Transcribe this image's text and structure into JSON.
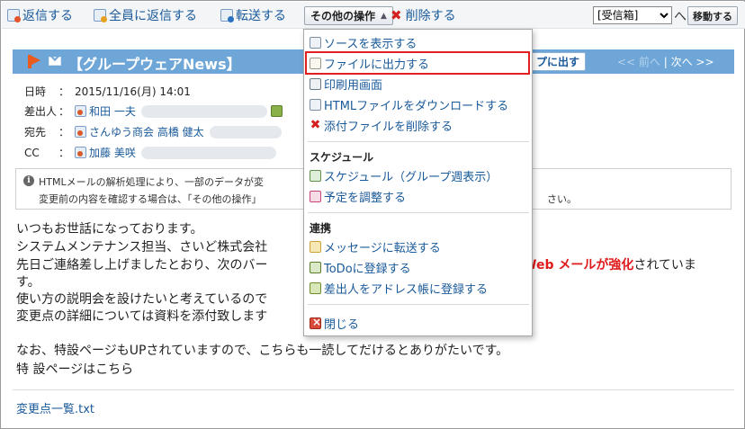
{
  "toolbar": {
    "reply": "返信する",
    "reply_all": "全員に返信する",
    "forward": "転送する",
    "other_actions": "その他の操作",
    "delete": "削除する",
    "folder_selected": "[受信箱]",
    "folder_suffix": "へ",
    "move": "移動する"
  },
  "message": {
    "subject": "【グループウェアNews】",
    "popout_button": "プに出す",
    "nav_prev": "<< 前へ",
    "nav_sep": " | ",
    "nav_next": "次へ >>",
    "fields": {
      "date_label": "日時",
      "date_value": "2015/11/16(月) 14:01",
      "from_label": "差出人",
      "from_value": "和田 一夫",
      "to_label": "宛先",
      "to_value": "さんゆう商会 高橋 健太",
      "cc_label": "CC",
      "cc_value": "加藤 美咲"
    },
    "notice": {
      "line1": "HTMLメールの解析処理により、一部のデータが変",
      "line2": "変更前の内容を確認する場合は、「その他の操作」",
      "line2_end": "さい。"
    },
    "body": {
      "line1": "いつもお世話になっております。",
      "line2": "システムメンテナンス担当、さいど株式会社",
      "line3_start": "先日ご連絡差し上げましたとおり、次のバー",
      "line3_bold": "Web メールが強化",
      "line3_end": "されていま",
      "line4": "す。",
      "line5": "使い方の説明会を設けたいと考えているので",
      "line6": "変更点の詳細については資料を添付致します",
      "line7": "なお、特設ページもUPされていますので、こちらも一読してだけるとありがたいです。",
      "link": "特 設ページはこちら"
    },
    "attachment": "変更点一覧.txt"
  },
  "menu": {
    "items": {
      "view_source": "ソースを表示する",
      "export_file": "ファイルに出力する",
      "print": "印刷用画面",
      "download_html": "HTMLファイルをダウンロードする",
      "delete_attachment": "添付ファイルを削除する"
    },
    "schedule_header": "スケジュール",
    "schedule": {
      "view_group_week": "スケジュール（グループ週表示）",
      "adjust": "予定を調整する"
    },
    "link_header": "連携",
    "link": {
      "forward_message": "メッセージに転送する",
      "add_todo": "ToDoに登録する",
      "add_address_book": "差出人をアドレス帳に登録する"
    },
    "close": "閉じる"
  },
  "colors": {
    "title_bar": "#6ea6d8",
    "link": "#1a5a9a",
    "highlight_border": "#e02020",
    "emphasis": "#e01a1a"
  }
}
